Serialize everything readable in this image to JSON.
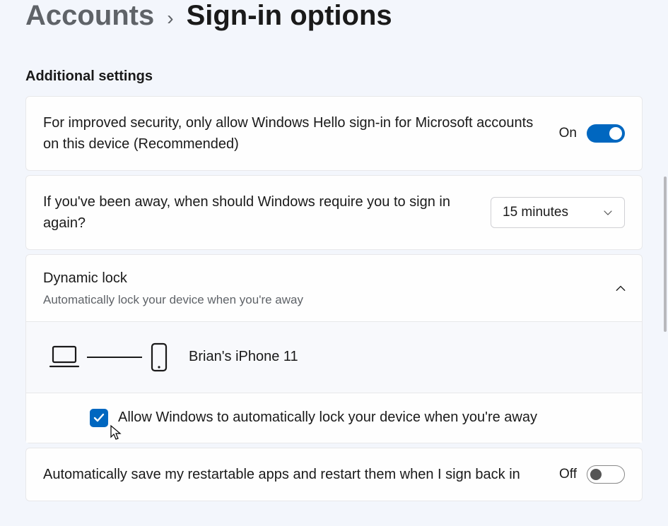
{
  "breadcrumb": {
    "parent": "Accounts",
    "current": "Sign-in options"
  },
  "section_title": "Additional settings",
  "hello_row": {
    "text": "For improved security, only allow Windows Hello sign-in for Microsoft accounts on this device (Recommended)",
    "state_label": "On"
  },
  "away_row": {
    "text": "If you've been away, when should Windows require you to sign in again?",
    "dropdown_value": "15 minutes"
  },
  "dynamic_lock": {
    "title": "Dynamic lock",
    "subtitle": "Automatically lock your device when you're away",
    "device_name": "Brian's iPhone 11",
    "checkbox_label": "Allow Windows to automatically lock your device when you're away"
  },
  "auto_save_row": {
    "text": "Automatically save my restartable apps and restart them when I sign back in",
    "state_label": "Off"
  }
}
